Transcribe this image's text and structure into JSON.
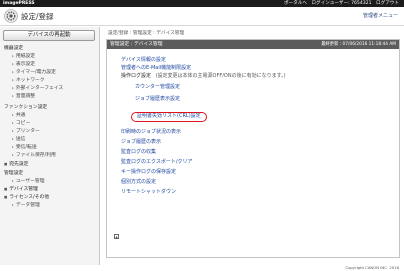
{
  "topbar": {
    "brand": "imagePRESS",
    "portal_link": "ポータルへ",
    "login_user": "ログインユーザー: 7654321",
    "logout": "ログアウト"
  },
  "header": {
    "title": "設定/登録",
    "menu_link": "管理者メニュー"
  },
  "sidebar": {
    "init_button": "デバイスの再起動",
    "items": [
      {
        "label": "機器設定",
        "type": "section"
      },
      {
        "label": "用紙設定",
        "type": "sub"
      },
      {
        "label": "表示設定",
        "type": "sub"
      },
      {
        "label": "タイマー/電力設定",
        "type": "sub"
      },
      {
        "label": "ネットワーク",
        "type": "sub"
      },
      {
        "label": "外部インターフェイス",
        "type": "sub"
      },
      {
        "label": "音量調整",
        "type": "sub"
      },
      {
        "label": "ファンクション設定",
        "type": "section"
      },
      {
        "label": "共通",
        "type": "sub"
      },
      {
        "label": "コピー",
        "type": "sub"
      },
      {
        "label": "プリンター",
        "type": "sub"
      },
      {
        "label": "送信",
        "type": "sub"
      },
      {
        "label": "受信/転送",
        "type": "sub"
      },
      {
        "label": "ファイル保存/利用",
        "type": "sub"
      },
      {
        "label": "宛先設定",
        "type": "bullet"
      },
      {
        "label": "管理設定",
        "type": "section"
      },
      {
        "label": "ユーザー管理",
        "type": "sub"
      },
      {
        "label": "デバイス管理",
        "type": "bullet"
      },
      {
        "label": "ライセンス/その他",
        "type": "bullet"
      },
      {
        "label": "データ管理",
        "type": "sub"
      }
    ]
  },
  "main": {
    "breadcrumb": "設定/登録 : 管理設定 : デバイス管理",
    "panel_title": "管理設定 : デバイス管理",
    "panel_date": "最終更新 : 07/06/2016 11:18:44 AM",
    "links": {
      "device_info": "デバイス情報の設定",
      "managed_by_user": "管理者へのE-Mail機能制限設定",
      "display_log_note": "(設定変更は本体の主電源OFF/ONの後に有効になります。)",
      "display_log_label": "操作ログ設定",
      "counter_sub": "カウンター管理設定",
      "jobs_sub": "ジョブ履歴表示設定",
      "highlight_sub": "証明書失効リスト(CRL)設定",
      "remote_job": "印刷時のジョブ状況の表示",
      "job_history": "ジョブ履歴の表示",
      "print_log": "監査ログの収集",
      "audit_log": "監査ログのエクスポート/クリア",
      "key_operation": "キー操作ログの保存設定",
      "private_settings": "個別方式の設定",
      "remote_shutdown": "リモートシャットダウン"
    }
  },
  "footer": {
    "copyright": "Copyright CANON INC. 2016"
  }
}
